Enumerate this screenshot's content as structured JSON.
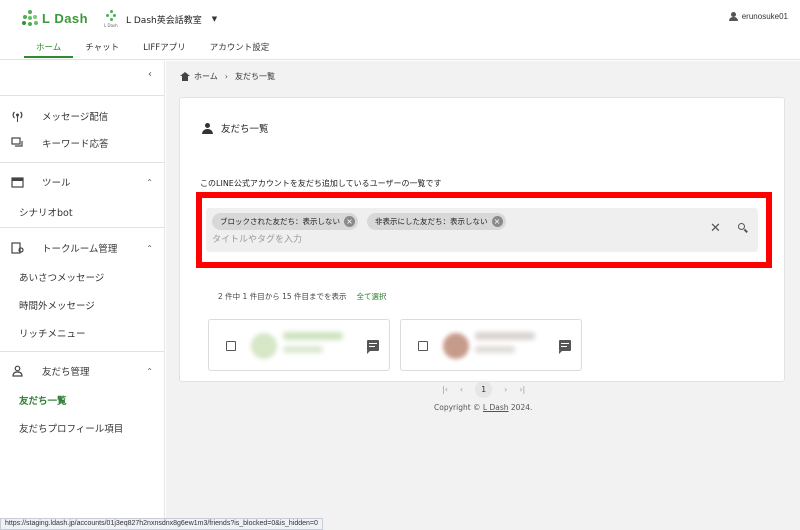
{
  "header": {
    "logo_text": "L Dash",
    "school_mini_text": "L Dash",
    "school_name": "L Dash英会話教室",
    "username": "erunosuke01",
    "tabs": [
      {
        "label": "ホーム",
        "active": true
      },
      {
        "label": "チャット",
        "active": false
      },
      {
        "label": "LIFFアプリ",
        "active": false
      },
      {
        "label": "アカウント設定",
        "active": false
      }
    ]
  },
  "sidebar": {
    "items": {
      "message": "メッセージ配信",
      "keyword": "キーワード応答",
      "tools": "ツール",
      "scenario": "シナリオbot",
      "talkroom": "トークルーム管理",
      "greeting": "あいさつメッセージ",
      "offhours": "時間外メッセージ",
      "richmenu": "リッチメニュー",
      "friends": "友だち管理",
      "friend_list": "友だち一覧",
      "friend_profile": "友だちプロフィール項目"
    }
  },
  "breadcrumb": {
    "home": "ホーム",
    "current": "友だち一覧"
  },
  "card": {
    "title": "友だち一覧",
    "description": "このLINE公式アカウントを友だち追加しているユーザーの一覧です",
    "filters": [
      "ブロックされた友だち：表示しない",
      "非表示にした友だち：表示しない"
    ],
    "search_placeholder": "タイトルやタグを入力",
    "count_text": "2 件中 1 件目から 15 件目までを表示",
    "select_all": "全て選択",
    "page_current": "1"
  },
  "footer": {
    "prefix": "Copyright © ",
    "link": "L Dash",
    "suffix": " 2024."
  },
  "status_url": "https://staging.ldash.jp/accounts/01j3eq827h2nxnsdnx8g6ew1m3/friends?is_blocked=0&is_hidden=0",
  "colors": {
    "brand_green": "#2e8b2e",
    "highlight_red": "#ff0000"
  }
}
